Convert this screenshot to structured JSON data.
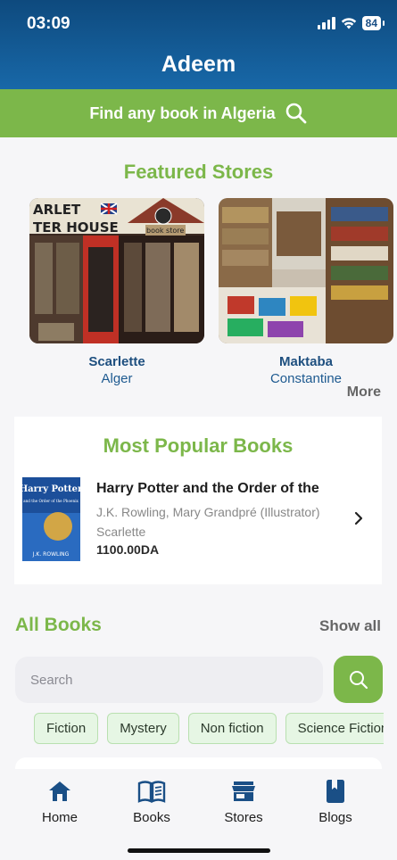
{
  "status_bar": {
    "time": "03:09",
    "battery": "84"
  },
  "header": {
    "title": "Adeem"
  },
  "search_banner": {
    "label": "Find any book in Algeria",
    "icon": "search-icon"
  },
  "featured": {
    "title": "Featured Stores",
    "stores": [
      {
        "name": "Scarlette",
        "city": "Alger",
        "sign_text": "ARLET  TER HOUSE",
        "small_sign": "book store"
      },
      {
        "name": "Maktaba",
        "city": "Constantine"
      }
    ],
    "more_label": "More"
  },
  "popular": {
    "title": "Most Popular Books",
    "books": [
      {
        "title": "Harry Potter and the Order of the",
        "author": "J.K. Rowling, Mary Grandpré (Illustrator)",
        "store": "Scarlette",
        "price": "1100.00DA",
        "cover_title": "Harry Potter",
        "cover_subtitle": "and the Order of the Phoenix",
        "cover_author": "J.K. ROWLING"
      }
    ]
  },
  "all_books": {
    "title": "All Books",
    "show_all_label": "Show all",
    "search_placeholder": "Search",
    "categories": [
      "Fiction",
      "Mystery",
      "Non fiction",
      "Science Fiction"
    ]
  },
  "tabbar": {
    "tabs": [
      {
        "label": "Home",
        "icon": "home-icon"
      },
      {
        "label": "Books",
        "icon": "book-open-icon"
      },
      {
        "label": "Stores",
        "icon": "store-icon"
      },
      {
        "label": "Blogs",
        "icon": "bookmark-book-icon"
      }
    ]
  },
  "colors": {
    "header": "#1868a8",
    "accent_green": "#7cb74a",
    "store_text": "#1e4f7f"
  }
}
